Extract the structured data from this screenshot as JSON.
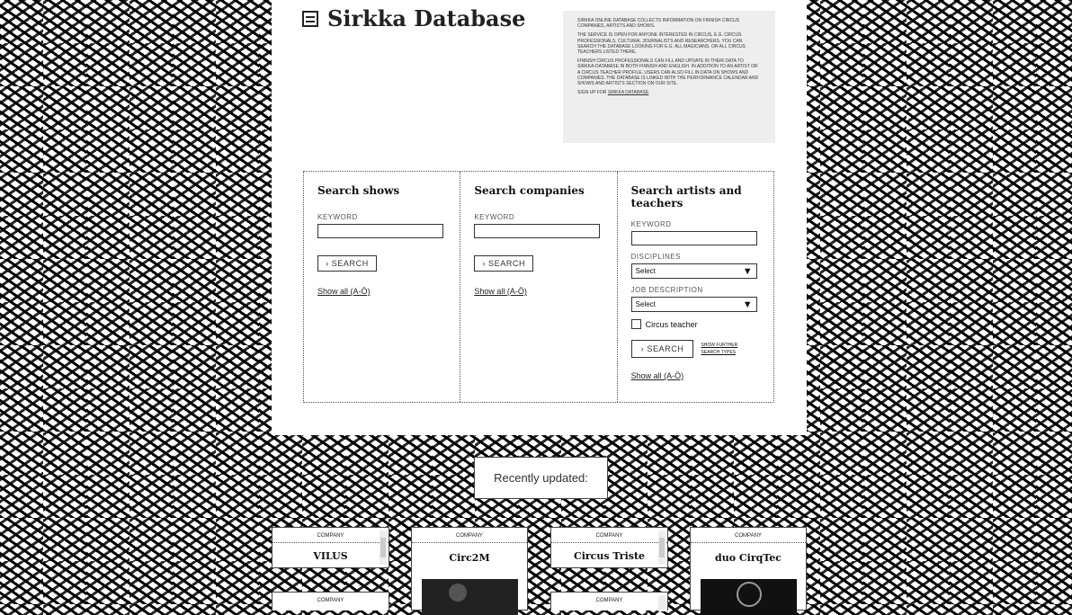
{
  "header": {
    "title": "Sirkka Database"
  },
  "info": {
    "p1": "Sirkka online database collects information on Finnish circus companies, artists and shows.",
    "p2": "The service is open for anyone interested in circus, e.g. circus professionals, cultural journalists and researchers. You can search the database looking for e.g. all magicians, or all circus teachers listed there.",
    "p3": "Finnish circus professionals can fill and update in their data to Sirkka-database in both Finnish and English. In addition to an artist or a circus teacher profile, users can also fill in data on shows and companies. The database is linked with the performance calendar and shows and artists section on our site.",
    "signup_prefix": "Sign up for ",
    "signup_link": "Sirkka database",
    "signup_suffix": "."
  },
  "search": {
    "shows": {
      "title": "Search shows",
      "keyword_label": "KEYWORD",
      "button": "› SEARCH",
      "show_all": "Show all (A-Ö)"
    },
    "companies": {
      "title": "Search companies",
      "keyword_label": "KEYWORD",
      "button": "› SEARCH",
      "show_all": "Show all (A-Ö)"
    },
    "artists": {
      "title": "Search artists and teachers",
      "keyword_label": "KEYWORD",
      "disciplines_label": "DISCIPLINES",
      "disciplines_value": "Select",
      "job_label": "JOB DESCRIPTION",
      "job_value": "Select",
      "circus_teacher": "Circus teacher",
      "button": "› SEARCH",
      "further_line1": "SHOW FURTHER",
      "further_line2": "SEARCH TYPES",
      "show_all": "Show all (A-Ö)"
    }
  },
  "recent": {
    "label": "Recently updated:",
    "cards": [
      {
        "type": "COMPANY",
        "name": "VILUS"
      },
      {
        "type": "COMPANY",
        "name": "Circ2M"
      },
      {
        "type": "COMPANY",
        "name": "Circus Triste"
      },
      {
        "type": "COMPANY",
        "name": "duo CirqTec"
      },
      {
        "type": "COMPANY",
        "name": ""
      },
      {
        "type": "COMPANY",
        "name": ""
      }
    ]
  }
}
